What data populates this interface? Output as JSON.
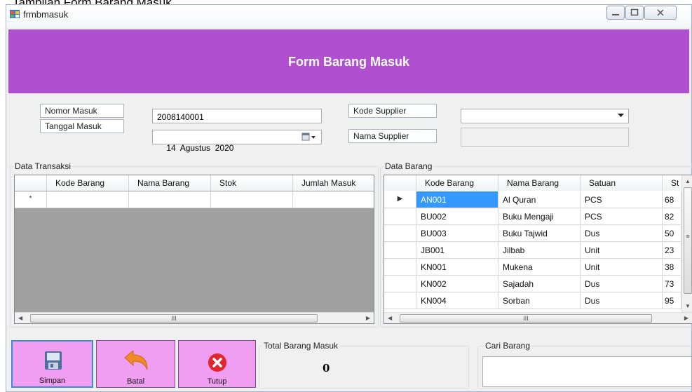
{
  "caption": "Tampilan Form Barang Masuk",
  "window": {
    "title": "frmbmasuk"
  },
  "header": {
    "title": "Form Barang Masuk"
  },
  "fields": {
    "nomor_masuk": {
      "label": "Nomor Masuk",
      "value": "2008140001"
    },
    "tanggal_masuk": {
      "label": "Tanggal Masuk",
      "value": "14  Agustus  2020"
    },
    "kode_supplier": {
      "label": "Kode Supplier",
      "value": ""
    },
    "nama_supplier": {
      "label": "Nama Supplier",
      "value": ""
    }
  },
  "transaksi": {
    "title": "Data Transaksi",
    "columns": [
      "Kode Barang",
      "Nama Barang",
      "Stok",
      "Jumlah Masuk"
    ],
    "new_row_marker": "*",
    "scroll_thumb": "III"
  },
  "barang": {
    "title": "Data Barang",
    "columns": [
      "Kode Barang",
      "Nama Barang",
      "Satuan",
      "St"
    ],
    "current_row_marker": "▶",
    "rows": [
      {
        "kode": "AN001",
        "nama": "Al Quran",
        "satuan": "PCS",
        "stok": "68"
      },
      {
        "kode": "BU002",
        "nama": "Buku Mengaji",
        "satuan": "PCS",
        "stok": "82"
      },
      {
        "kode": "BU003",
        "nama": "Buku Tajwid",
        "satuan": "Dus",
        "stok": "50"
      },
      {
        "kode": "JB001",
        "nama": "Jilbab",
        "satuan": "Unit",
        "stok": "23"
      },
      {
        "kode": "KN001",
        "nama": "Mukena",
        "satuan": "Unit",
        "stok": "38"
      },
      {
        "kode": "KN002",
        "nama": "Sajadah",
        "satuan": "Dus",
        "stok": "73"
      },
      {
        "kode": "KN004",
        "nama": "Sorban",
        "satuan": "Dus",
        "stok": "95"
      }
    ],
    "selected_row": 0,
    "scroll_thumb": "III",
    "vscroll_thumb": "≡"
  },
  "buttons": {
    "simpan": "Simpan",
    "batal": "Batal",
    "tutup": "Tutup"
  },
  "total": {
    "title": "Total Barang Masuk",
    "value": "0"
  },
  "search": {
    "title": "Cari Barang",
    "value": ""
  },
  "colors": {
    "header": "#b04fd0",
    "button": "#f09ef2",
    "selection": "#3399ff"
  },
  "icons": [
    "save-icon",
    "undo-arrow-icon",
    "close-x-icon",
    "calendar-icon",
    "dropdown-arrow-icon"
  ]
}
